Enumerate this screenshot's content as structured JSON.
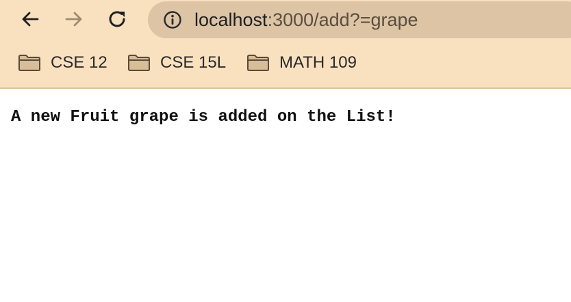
{
  "toolbar": {
    "back_icon": "arrow-left-icon",
    "forward_icon": "arrow-right-icon",
    "reload_icon": "reload-icon",
    "info_icon": "info-icon"
  },
  "address_bar": {
    "host": "localhost",
    "rest": ":3000/add?=grape"
  },
  "bookmarks": [
    {
      "label": "CSE 12",
      "icon": "folder-icon"
    },
    {
      "label": "CSE 15L",
      "icon": "folder-icon"
    },
    {
      "label": "MATH 109",
      "icon": "folder-icon"
    }
  ],
  "page": {
    "message": "A new Fruit grape is added on the List!"
  },
  "colors": {
    "chrome_bg": "#f9e0bf",
    "omnibox_bg": "#dcc4a5",
    "forward_disabled": "#a08a6f"
  }
}
